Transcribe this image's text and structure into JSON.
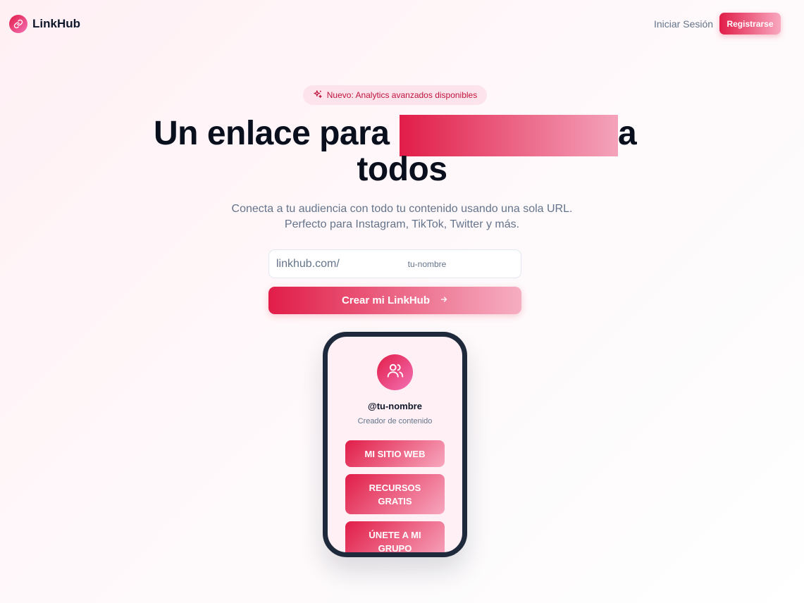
{
  "header": {
    "brand_name": "LinkHub",
    "brand_icon": "link-icon",
    "login_label": "Iniciar Sesión",
    "register_label": "Registrarse"
  },
  "hero": {
    "badge_text": "Nuevo: Analytics avanzados disponibles",
    "badge_icon": "sparkles-icon",
    "headline_line1": "Un enlace para",
    "headline_suffix": "a",
    "headline_line2": "todos",
    "subtitle_line1": "Conecta a tu audiencia con todo tu contenido usando una sola URL.",
    "subtitle_line2": "Perfecto para Instagram, TikTok, Twitter y más."
  },
  "signup": {
    "url_prefix": "linkhub.com/",
    "url_placeholder": "tu-nombre",
    "cta_label": "Crear mi LinkHub",
    "cta_icon": "arrow-right-icon"
  },
  "phone_preview": {
    "avatar_icon": "users-icon",
    "handle": "@tu-nombre",
    "role": "Creador de contenido",
    "links": [
      {
        "label": "MI SITIO WEB"
      },
      {
        "label": "RECURSOS GRATIS"
      },
      {
        "label": "ÚNETE A MI GRUPO"
      }
    ]
  },
  "colors": {
    "accent": "#e11d48",
    "accent_light": "#f4a3bb",
    "text_dark": "#0f172a",
    "text_muted": "#64748b"
  }
}
